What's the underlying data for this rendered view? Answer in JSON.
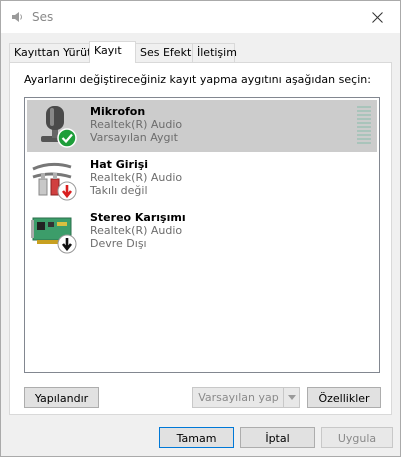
{
  "window": {
    "title": "Ses"
  },
  "tabs": [
    {
      "label": "Kayıttan Yürüt"
    },
    {
      "label": "Kayıt"
    },
    {
      "label": "Ses Efekti"
    },
    {
      "label": "İletişim"
    }
  ],
  "instruction": "Ayarlarını değiştireceğiniz kayıt yapma aygıtını aşağıdan seçin:",
  "devices": [
    {
      "name": "Mikrofon",
      "driver": "Realtek(R) Audio",
      "status": "Varsayılan Aygıt",
      "icon": "microphone-icon",
      "badge": "check-badge-icon"
    },
    {
      "name": "Hat Girişi",
      "driver": "Realtek(R) Audio",
      "status": "Takılı değil",
      "icon": "line-in-cable-icon",
      "badge": "red-down-arrow-badge-icon"
    },
    {
      "name": "Stereo Karışımı",
      "driver": "Realtek(R) Audio",
      "status": "Devre Dışı",
      "icon": "sound-card-icon",
      "badge": "black-down-arrow-badge-icon"
    }
  ],
  "buttons": {
    "configure": "Yapılandır",
    "set_default": "Varsayılan yap",
    "properties": "Özellikler",
    "ok": "Tamam",
    "cancel": "İptal",
    "apply": "Uygula"
  },
  "colors": {
    "selected_row": "#cccccc",
    "check_green": "#1e9e3a",
    "focus_blue": "#0078d7"
  }
}
